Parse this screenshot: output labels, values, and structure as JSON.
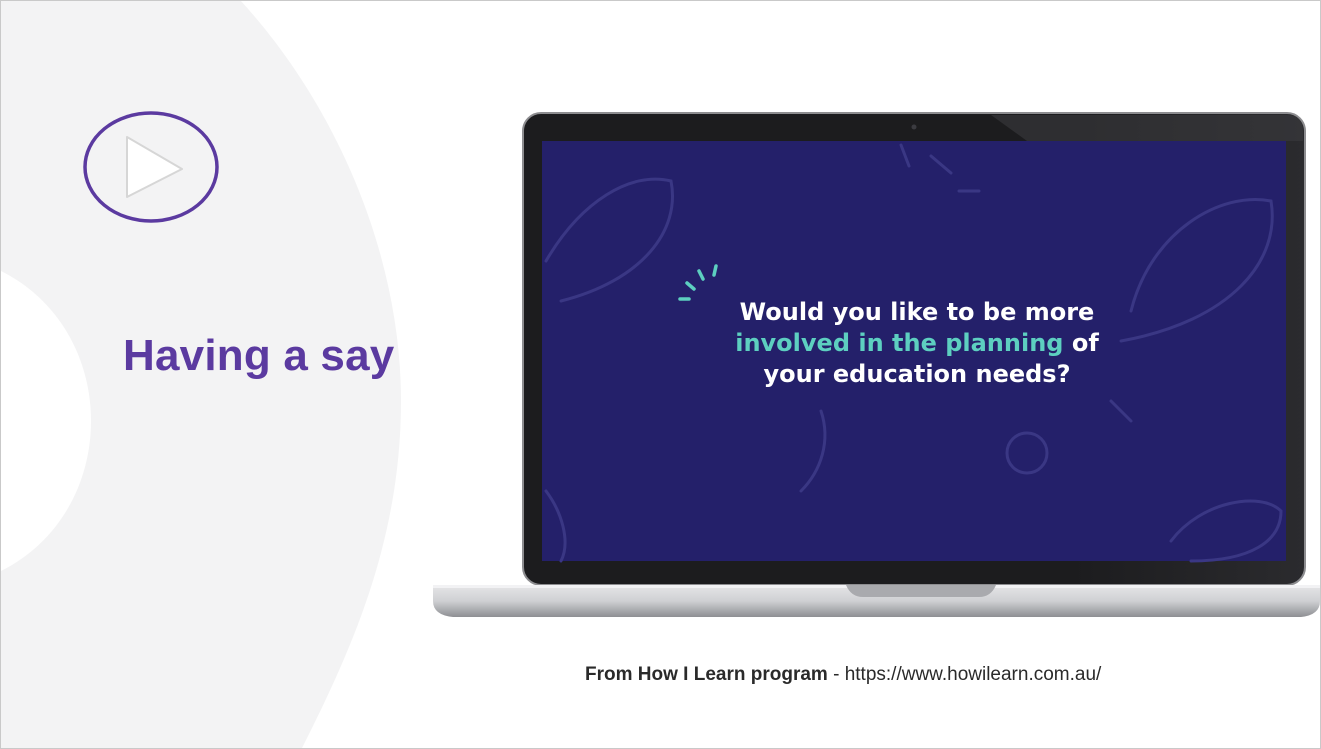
{
  "slide": {
    "title": "Having a say"
  },
  "video": {
    "question": {
      "line1": "Would you like to be more",
      "line2_highlight": "involved in the planning",
      "line2_rest": " of",
      "line3": "your education needs?"
    },
    "screen_color": "#24206a",
    "highlight_color": "#5dcfc0"
  },
  "caption": {
    "source_label": "From How I Learn program",
    "separator": " - ",
    "url": "https://www.howilearn.com.au/"
  },
  "colors": {
    "accent": "#5b3aa0",
    "background_arc": "#f3f3f4"
  },
  "icons": {
    "play": "play-icon"
  }
}
